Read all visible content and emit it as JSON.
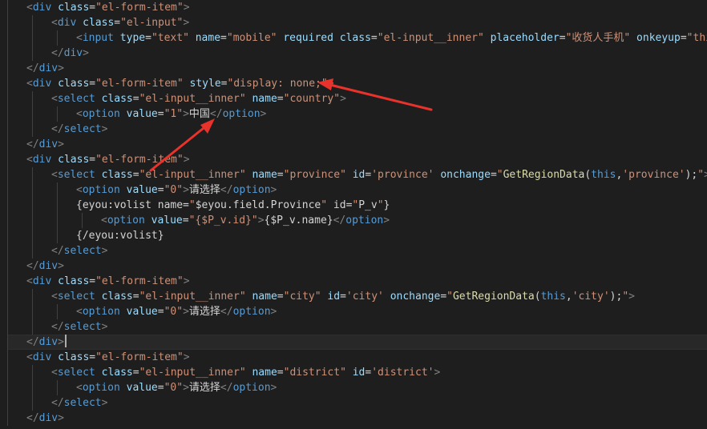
{
  "colors": {
    "background": "#1e1e1e",
    "punctuation": "#808080",
    "tag": "#569cd6",
    "attribute": "#9cdcfe",
    "string": "#ce9178",
    "text": "#d4d4d4",
    "escape_error": "#f44747",
    "function": "#dcdcaa",
    "annotation_arrow": "#e8322b"
  },
  "editor": {
    "current_line": 22,
    "lines": [
      {
        "indent": 1,
        "tokens": [
          [
            "p",
            "<"
          ],
          [
            "t",
            "div"
          ],
          [
            "x",
            " "
          ],
          [
            "a",
            "class"
          ],
          [
            "x",
            "="
          ],
          [
            "v",
            "\"el-form-item\""
          ],
          [
            "p",
            ">"
          ]
        ]
      },
      {
        "indent": 2,
        "tokens": [
          [
            "p",
            "<"
          ],
          [
            "t",
            "div"
          ],
          [
            "x",
            " "
          ],
          [
            "a",
            "class"
          ],
          [
            "x",
            "="
          ],
          [
            "v",
            "\"el-input\""
          ],
          [
            "p",
            ">"
          ]
        ]
      },
      {
        "indent": 3,
        "tokens": [
          [
            "p",
            "<"
          ],
          [
            "t",
            "input"
          ],
          [
            "x",
            " "
          ],
          [
            "a",
            "type"
          ],
          [
            "x",
            "="
          ],
          [
            "v",
            "\"text\""
          ],
          [
            "x",
            " "
          ],
          [
            "a",
            "name"
          ],
          [
            "x",
            "="
          ],
          [
            "v",
            "\"mobile\""
          ],
          [
            "x",
            " "
          ],
          [
            "a",
            "required"
          ],
          [
            "x",
            " "
          ],
          [
            "a",
            "class"
          ],
          [
            "x",
            "="
          ],
          [
            "v",
            "\"el-input__inner\""
          ],
          [
            "x",
            " "
          ],
          [
            "a",
            "placeholder"
          ],
          [
            "x",
            "="
          ],
          [
            "v",
            "\"收货人手机\""
          ],
          [
            "x",
            " "
          ],
          [
            "a",
            "onkeyup"
          ],
          [
            "x",
            "="
          ],
          [
            "v",
            "\"thi"
          ]
        ]
      },
      {
        "indent": 2,
        "tokens": [
          [
            "p",
            "</"
          ],
          [
            "t",
            "div"
          ],
          [
            "p",
            ">"
          ]
        ]
      },
      {
        "indent": 1,
        "tokens": [
          [
            "p",
            "</"
          ],
          [
            "t",
            "div"
          ],
          [
            "p",
            ">"
          ]
        ]
      },
      {
        "indent": 1,
        "tokens": [
          [
            "p",
            "<"
          ],
          [
            "t",
            "div"
          ],
          [
            "x",
            " "
          ],
          [
            "a",
            "class"
          ],
          [
            "x",
            "="
          ],
          [
            "v",
            "\"el-form-item\""
          ],
          [
            "x",
            " "
          ],
          [
            "a",
            "style"
          ],
          [
            "x",
            "="
          ],
          [
            "v",
            "\"display: none;\""
          ],
          [
            "p",
            ">"
          ]
        ]
      },
      {
        "indent": 2,
        "tokens": [
          [
            "p",
            "<"
          ],
          [
            "t",
            "select"
          ],
          [
            "x",
            " "
          ],
          [
            "a",
            "class"
          ],
          [
            "x",
            "="
          ],
          [
            "v",
            "\"el-input__inner\""
          ],
          [
            "x",
            " "
          ],
          [
            "a",
            "name"
          ],
          [
            "x",
            "="
          ],
          [
            "v",
            "\"country\""
          ],
          [
            "p",
            ">"
          ]
        ]
      },
      {
        "indent": 3,
        "tokens": [
          [
            "p",
            "<"
          ],
          [
            "t",
            "option"
          ],
          [
            "x",
            " "
          ],
          [
            "a",
            "value"
          ],
          [
            "x",
            "="
          ],
          [
            "v",
            "\"1\""
          ],
          [
            "p",
            ">"
          ],
          [
            "x",
            "中国"
          ],
          [
            "p",
            "</"
          ],
          [
            "t",
            "option"
          ],
          [
            "p",
            ">"
          ]
        ]
      },
      {
        "indent": 2,
        "tokens": [
          [
            "p",
            "</"
          ],
          [
            "t",
            "select"
          ],
          [
            "p",
            ">"
          ]
        ]
      },
      {
        "indent": 1,
        "tokens": [
          [
            "p",
            "</"
          ],
          [
            "t",
            "div"
          ],
          [
            "p",
            ">"
          ]
        ]
      },
      {
        "indent": 1,
        "tokens": [
          [
            "p",
            "<"
          ],
          [
            "t",
            "div"
          ],
          [
            "x",
            " "
          ],
          [
            "a",
            "class"
          ],
          [
            "x",
            "="
          ],
          [
            "v",
            "\"el-form-item\""
          ],
          [
            "p",
            ">"
          ]
        ]
      },
      {
        "indent": 2,
        "tokens": [
          [
            "p",
            "<"
          ],
          [
            "t",
            "select"
          ],
          [
            "x",
            " "
          ],
          [
            "a",
            "class"
          ],
          [
            "x",
            "="
          ],
          [
            "v",
            "\"el-input__inner\""
          ],
          [
            "x",
            " "
          ],
          [
            "a",
            "name"
          ],
          [
            "x",
            "="
          ],
          [
            "v",
            "\"province\""
          ],
          [
            "x",
            " "
          ],
          [
            "a",
            "id"
          ],
          [
            "x",
            "="
          ],
          [
            "v",
            "'province'"
          ],
          [
            "x",
            " "
          ],
          [
            "a",
            "onchange"
          ],
          [
            "x",
            "="
          ],
          [
            "v",
            "\""
          ],
          [
            "f",
            "GetRegionData"
          ],
          [
            "x",
            "("
          ],
          [
            "t",
            "this"
          ],
          [
            "x",
            ","
          ],
          [
            "v",
            "'province'"
          ],
          [
            "x",
            ");"
          ],
          [
            "v",
            "\""
          ],
          [
            "p",
            ">"
          ]
        ]
      },
      {
        "indent": 3,
        "tokens": [
          [
            "p",
            "<"
          ],
          [
            "t",
            "option"
          ],
          [
            "x",
            " "
          ],
          [
            "a",
            "value"
          ],
          [
            "x",
            "="
          ],
          [
            "v",
            "\"0\""
          ],
          [
            "p",
            ">"
          ],
          [
            "x",
            "请选择"
          ],
          [
            "p",
            "</"
          ],
          [
            "t",
            "option"
          ],
          [
            "p",
            ">"
          ]
        ]
      },
      {
        "indent": 3,
        "tokens": [
          [
            "x",
            "{eyou:volist name="
          ],
          [
            "v",
            "\""
          ],
          [
            "x",
            "$eyou.field.Province"
          ],
          [
            "v",
            "\""
          ],
          [
            "x",
            " id="
          ],
          [
            "v",
            "\""
          ],
          [
            "x",
            "P_v"
          ],
          [
            "v",
            "\""
          ],
          [
            "x",
            "}"
          ]
        ]
      },
      {
        "indent": 4,
        "tokens": [
          [
            "p",
            "<"
          ],
          [
            "t",
            "option"
          ],
          [
            "x",
            " "
          ],
          [
            "a",
            "value"
          ],
          [
            "x",
            "="
          ],
          [
            "v",
            "\"{$P_v.id}\""
          ],
          [
            "p",
            ">"
          ],
          [
            "x",
            "{$P_v.name}"
          ],
          [
            "p",
            "</"
          ],
          [
            "t",
            "option"
          ],
          [
            "p",
            ">"
          ]
        ]
      },
      {
        "indent": 3,
        "tokens": [
          [
            "x",
            "{/eyou:volist}"
          ]
        ]
      },
      {
        "indent": 2,
        "tokens": [
          [
            "p",
            "</"
          ],
          [
            "t",
            "select"
          ],
          [
            "p",
            ">"
          ]
        ]
      },
      {
        "indent": 1,
        "tokens": [
          [
            "p",
            "</"
          ],
          [
            "t",
            "div"
          ],
          [
            "p",
            ">"
          ]
        ]
      },
      {
        "indent": 1,
        "tokens": [
          [
            "p",
            "<"
          ],
          [
            "t",
            "div"
          ],
          [
            "x",
            " "
          ],
          [
            "a",
            "class"
          ],
          [
            "x",
            "="
          ],
          [
            "v",
            "\"el-form-item\""
          ],
          [
            "p",
            ">"
          ]
        ]
      },
      {
        "indent": 2,
        "tokens": [
          [
            "p",
            "<"
          ],
          [
            "t",
            "select"
          ],
          [
            "x",
            " "
          ],
          [
            "a",
            "class"
          ],
          [
            "x",
            "="
          ],
          [
            "v",
            "\"el-input__inner\""
          ],
          [
            "x",
            " "
          ],
          [
            "a",
            "name"
          ],
          [
            "x",
            "="
          ],
          [
            "v",
            "\"city\""
          ],
          [
            "x",
            " "
          ],
          [
            "a",
            "id"
          ],
          [
            "x",
            "="
          ],
          [
            "v",
            "'city'"
          ],
          [
            "x",
            " "
          ],
          [
            "a",
            "onchange"
          ],
          [
            "x",
            "="
          ],
          [
            "v",
            "\""
          ],
          [
            "f",
            "GetRegionData"
          ],
          [
            "x",
            "("
          ],
          [
            "t",
            "this"
          ],
          [
            "x",
            ","
          ],
          [
            "v",
            "'city'"
          ],
          [
            "x",
            ");"
          ],
          [
            "v",
            "\""
          ],
          [
            "p",
            ">"
          ]
        ]
      },
      {
        "indent": 3,
        "tokens": [
          [
            "p",
            "<"
          ],
          [
            "t",
            "option"
          ],
          [
            "x",
            " "
          ],
          [
            "a",
            "value"
          ],
          [
            "x",
            "="
          ],
          [
            "v",
            "\"0\""
          ],
          [
            "p",
            ">"
          ],
          [
            "x",
            "请选择"
          ],
          [
            "p",
            "</"
          ],
          [
            "t",
            "option"
          ],
          [
            "p",
            ">"
          ]
        ]
      },
      {
        "indent": 2,
        "tokens": [
          [
            "p",
            "</"
          ],
          [
            "t",
            "select"
          ],
          [
            "p",
            ">"
          ]
        ]
      },
      {
        "indent": 1,
        "tokens": [
          [
            "p",
            "</"
          ],
          [
            "t",
            "div"
          ],
          [
            "p",
            ">"
          ]
        ]
      },
      {
        "indent": 1,
        "tokens": [
          [
            "p",
            "<"
          ],
          [
            "t",
            "div"
          ],
          [
            "x",
            " "
          ],
          [
            "a",
            "class"
          ],
          [
            "x",
            "="
          ],
          [
            "v",
            "\"el-form-item\""
          ],
          [
            "p",
            ">"
          ]
        ]
      },
      {
        "indent": 2,
        "tokens": [
          [
            "p",
            "<"
          ],
          [
            "t",
            "select"
          ],
          [
            "x",
            " "
          ],
          [
            "a",
            "class"
          ],
          [
            "x",
            "="
          ],
          [
            "v",
            "\"el-input__inner\""
          ],
          [
            "x",
            " "
          ],
          [
            "a",
            "name"
          ],
          [
            "x",
            "="
          ],
          [
            "v",
            "\"district\""
          ],
          [
            "x",
            " "
          ],
          [
            "a",
            "id"
          ],
          [
            "x",
            "="
          ],
          [
            "v",
            "'district'"
          ],
          [
            "p",
            ">"
          ]
        ]
      },
      {
        "indent": 3,
        "tokens": [
          [
            "p",
            "<"
          ],
          [
            "t",
            "option"
          ],
          [
            "x",
            " "
          ],
          [
            "a",
            "value"
          ],
          [
            "x",
            "="
          ],
          [
            "v",
            "\"0\""
          ],
          [
            "p",
            ">"
          ],
          [
            "x",
            "请选择"
          ],
          [
            "p",
            "</"
          ],
          [
            "t",
            "option"
          ],
          [
            "p",
            ">"
          ]
        ]
      },
      {
        "indent": 2,
        "tokens": [
          [
            "p",
            "</"
          ],
          [
            "t",
            "select"
          ],
          [
            "p",
            ">"
          ]
        ]
      },
      {
        "indent": 1,
        "tokens": [
          [
            "p",
            "</"
          ],
          [
            "t",
            "div"
          ],
          [
            "p",
            ">"
          ]
        ]
      }
    ]
  },
  "annotations": {
    "arrows": [
      {
        "points_at": "display: none;"
      },
      {
        "points_at": "中国"
      }
    ]
  }
}
